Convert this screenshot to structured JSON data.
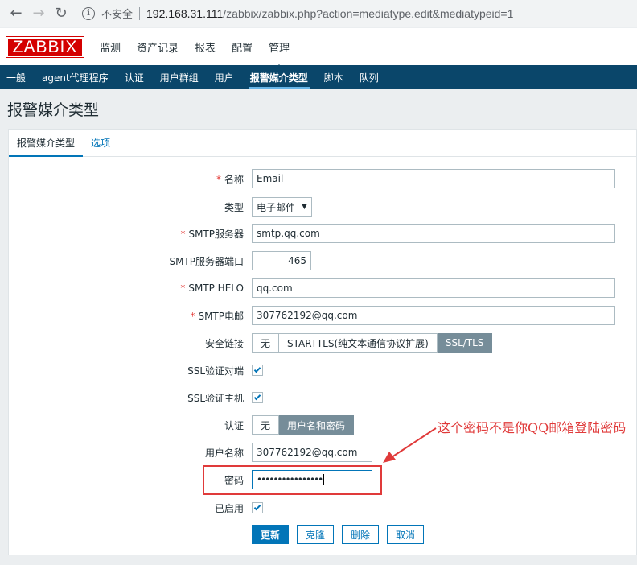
{
  "browser": {
    "insecure_label": "不安全",
    "url_host": "192.168.31.111",
    "url_path": "/zabbix/zabbix.php?action=mediatype.edit&mediatypeid=1"
  },
  "header": {
    "logo": "ZABBIX",
    "menu": [
      "监测",
      "资产记录",
      "报表",
      "配置",
      "管理"
    ]
  },
  "submenu": [
    "一般",
    "agent代理程序",
    "认证",
    "用户群组",
    "用户",
    "报警媒介类型",
    "脚本",
    "队列"
  ],
  "page_title": "报警媒介类型",
  "tabs": [
    "报警媒介类型",
    "选项"
  ],
  "form": {
    "name_label": "名称",
    "name_value": "Email",
    "type_label": "类型",
    "type_value": "电子邮件",
    "smtp_server_label": "SMTP服务器",
    "smtp_server_value": "smtp.qq.com",
    "smtp_port_label": "SMTP服务器端口",
    "smtp_port_value": "465",
    "smtp_helo_label": "SMTP HELO",
    "smtp_helo_value": "qq.com",
    "smtp_email_label": "SMTP电邮",
    "smtp_email_value": "307762192@qq.com",
    "security_label": "安全链接",
    "security_options": [
      "无",
      "STARTTLS(纯文本通信协议扩展)",
      "SSL/TLS"
    ],
    "security_selected": "SSL/TLS",
    "ssl_verify_peer_label": "SSL验证对端",
    "ssl_verify_peer_checked": true,
    "ssl_verify_host_label": "SSL验证主机",
    "ssl_verify_host_checked": true,
    "auth_label": "认证",
    "auth_options": [
      "无",
      "用户名和密码"
    ],
    "auth_selected": "用户名和密码",
    "username_label": "用户名称",
    "username_value": "307762192@qq.com",
    "password_label": "密码",
    "password_value": "••••••••••••••••",
    "enabled_label": "已启用",
    "enabled_checked": true
  },
  "buttons": {
    "update": "更新",
    "clone": "克隆",
    "delete": "删除",
    "cancel": "取消"
  },
  "annotation": "这个密码不是你QQ邮箱登陆密码",
  "colors": {
    "zabbix_red": "#d40000",
    "submenu_bg": "#0a466a",
    "primary_blue": "#0275b8",
    "annotation_red": "#e03a3a"
  }
}
